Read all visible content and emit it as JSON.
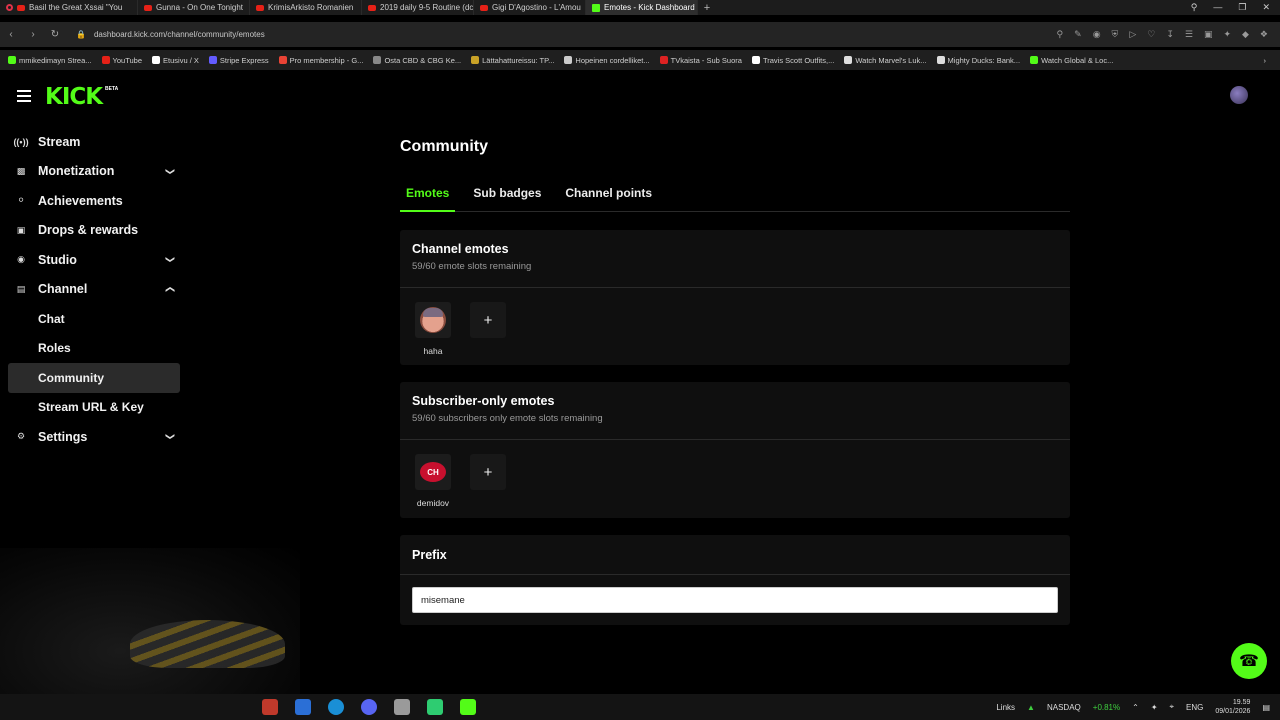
{
  "browser": {
    "tabs": [
      {
        "label": "Basil the Great Xssai \"You"
      },
      {
        "label": "Gunna - On One Tonight"
      },
      {
        "label": "KrimisArkisto Romanien"
      },
      {
        "label": "2019 daily 9-5 Routine (dc"
      },
      {
        "label": "Gigi D'Agostino - L'Amou"
      },
      {
        "label": "Emotes - Kick Dashboard"
      }
    ],
    "url": "dashboard.kick.com/channel/community/emotes",
    "bookmarks": [
      {
        "label": "mmikedimayn Strea...",
        "color": "#53fc18"
      },
      {
        "label": "YouTube",
        "color": "#e62117"
      },
      {
        "label": "Etusivu / X",
        "color": "#ffffff"
      },
      {
        "label": "Stripe Express",
        "color": "#635bff"
      },
      {
        "label": "Pro membership - G...",
        "color": "#ea4335"
      },
      {
        "label": "Osta CBD & CBG Ke...",
        "color": "#888888"
      },
      {
        "label": "Lättahattureissu: TP...",
        "color": "#c9a227"
      },
      {
        "label": "Hopeinen cordelliket...",
        "color": "#cccccc"
      },
      {
        "label": "TVkaista - Sub Suora",
        "color": "#d22"
      },
      {
        "label": "Travis Scott Outfits,...",
        "color": "#ffffff"
      },
      {
        "label": "Watch Marvel's Luk...",
        "color": "#dddddd"
      },
      {
        "label": "Mighty Ducks: Bank...",
        "color": "#dddddd"
      },
      {
        "label": "Watch Global & Loc...",
        "color": "#53fc18"
      }
    ]
  },
  "brand": {
    "logo": "KICK",
    "beta": "BETA",
    "accent": "#53fc18"
  },
  "sidebar": {
    "items": [
      {
        "label": "Stream",
        "icon": "broadcast-icon"
      },
      {
        "label": "Monetization",
        "icon": "chart-icon",
        "expandable": true
      },
      {
        "label": "Achievements",
        "icon": "trophy-icon"
      },
      {
        "label": "Drops & rewards",
        "icon": "gift-icon"
      },
      {
        "label": "Studio",
        "icon": "studio-icon",
        "expandable": true
      },
      {
        "label": "Channel",
        "icon": "channel-icon",
        "expanded": true
      },
      {
        "label": "Chat",
        "sub": true
      },
      {
        "label": "Roles",
        "sub": true
      },
      {
        "label": "Community",
        "sub": true,
        "active": true
      },
      {
        "label": "Stream URL & Key",
        "sub": true
      },
      {
        "label": "Settings",
        "icon": "gear-icon",
        "expandable": true
      }
    ]
  },
  "main": {
    "title": "Community",
    "tabs": [
      {
        "label": "Emotes",
        "active": true
      },
      {
        "label": "Sub badges"
      },
      {
        "label": "Channel points"
      }
    ],
    "channel_emotes": {
      "title": "Channel emotes",
      "subtitle": "59/60 emote slots remaining",
      "emotes": [
        {
          "name": "haha"
        }
      ]
    },
    "sub_emotes": {
      "title": "Subscriber-only emotes",
      "subtitle": "59/60 subscribers only emote slots remaining",
      "emotes": [
        {
          "name": "demidov"
        }
      ]
    },
    "prefix": {
      "title": "Prefix",
      "value": "misemane"
    }
  },
  "taskbar": {
    "links": "Links",
    "stock_name": "NASDAQ",
    "stock_change": "+0.81%",
    "lang": "ENG",
    "time": "19.59",
    "date": "09/01/2026"
  }
}
